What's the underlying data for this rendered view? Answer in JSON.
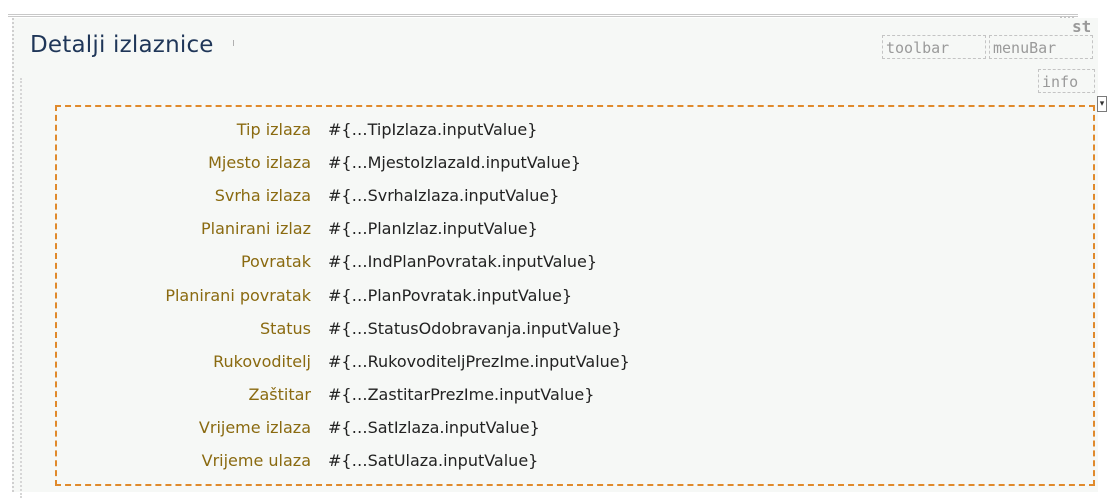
{
  "panel": {
    "title": "Detalji izlaznice"
  },
  "facets": {
    "status": "st",
    "toolbar": "toolbar",
    "menubar": "menuBar",
    "info": "info"
  },
  "dropdown_marker": "▾",
  "fields": [
    {
      "label": "Tip izlaza",
      "value": "#{…TipIzlaza.inputValue}"
    },
    {
      "label": "Mjesto izlaza",
      "value": "#{…MjestoIzlazaId.inputValue}"
    },
    {
      "label": "Svrha izlaza",
      "value": "#{…SvrhaIzlaza.inputValue}"
    },
    {
      "label": "Planirani izlaz",
      "value": "#{…PlanIzlaz.inputValue}"
    },
    {
      "label": "Povratak",
      "value": "#{…IndPlanPovratak.inputValue}"
    },
    {
      "label": "Planirani povratak",
      "value": "#{…PlanPovratak.inputValue}"
    },
    {
      "label": "Status",
      "value": "#{…StatusOdobravanja.inputValue}"
    },
    {
      "label": "Rukovoditelj",
      "value": "#{…RukovoditeljPrezIme.inputValue}"
    },
    {
      "label": "Zaštitar",
      "value": "#{…ZastitarPrezIme.inputValue}"
    },
    {
      "label": "Vrijeme izlaza",
      "value": "#{…SatIzlaza.inputValue}"
    },
    {
      "label": "Vrijeme ulaza",
      "value": "#{…SatUlaza.inputValue}"
    }
  ],
  "colors": {
    "label": "#8a6a10",
    "value": "#222222",
    "title": "#1f3658",
    "group_border": "#e08a2c",
    "panel_bg": "#f6f8f6"
  }
}
